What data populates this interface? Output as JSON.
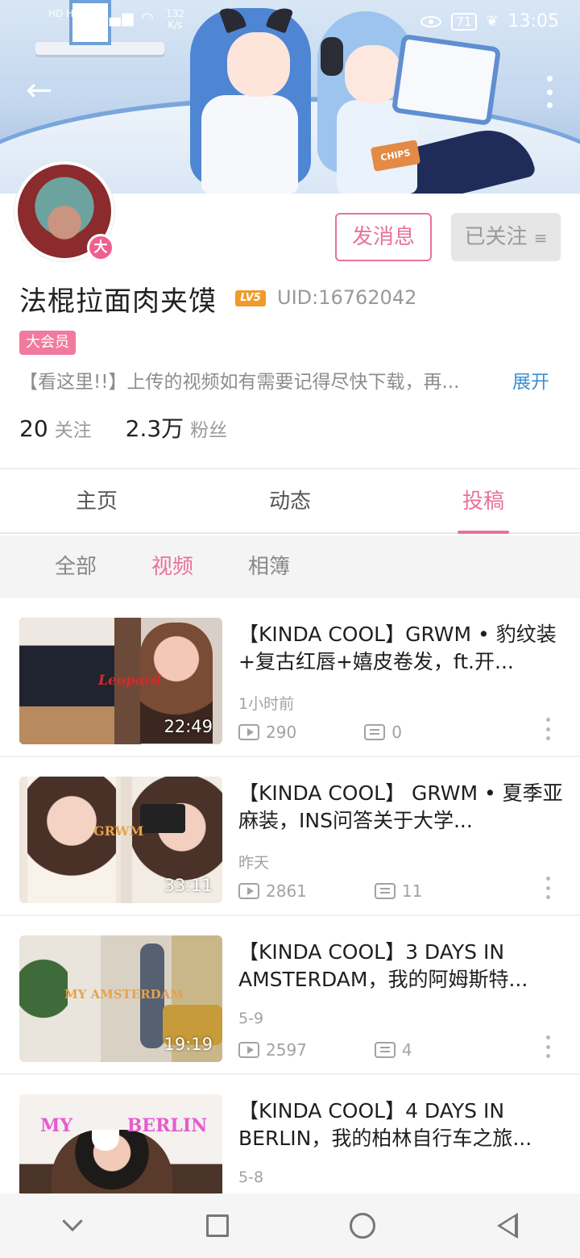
{
  "status_bar": {
    "network_left": "HD HD",
    "speed_value": "132",
    "speed_unit": "K/s",
    "battery": "71",
    "time": "13:05"
  },
  "banner": {
    "chips_text": "CHIPS"
  },
  "profile": {
    "avatar_badge": "大",
    "message_button": "发消息",
    "follow_button": "已关注",
    "name": "法棍拉面肉夹馍",
    "level_badge": "LV5",
    "uid": "UID:16762042",
    "member_tag": "大会员",
    "bio": "【看这里!!】上传的视频如有需要记得尽快下载，再...",
    "expand": "展开",
    "following_count": "20",
    "following_label": "关注",
    "followers_count": "2.3万",
    "followers_label": "粉丝"
  },
  "main_tabs": [
    {
      "label": "主页",
      "active": false
    },
    {
      "label": "动态",
      "active": false
    },
    {
      "label": "投稿",
      "active": true
    }
  ],
  "sub_tabs": [
    {
      "label": "全部",
      "active": false
    },
    {
      "label": "视频",
      "active": true
    },
    {
      "label": "相簿",
      "active": false
    }
  ],
  "videos": [
    {
      "title": "【KINDA COOL】GRWM • 豹纹装+复古红唇+嬉皮卷发，ft.开...",
      "time": "1小时前",
      "plays": "290",
      "comments": "0",
      "duration": "22:49",
      "thumb_label": "Leopard"
    },
    {
      "title": "【KINDA COOL】 GRWM • 夏季亚麻装，INS问答关于大学...",
      "time": "昨天",
      "plays": "2861",
      "comments": "11",
      "duration": "33:11",
      "thumb_label": "GRWM"
    },
    {
      "title": "【KINDA COOL】3 DAYS IN AMSTERDAM，我的阿姆斯特...",
      "time": "5-9",
      "plays": "2597",
      "comments": "4",
      "duration": "19:19",
      "thumb_label": "MY AMSTERDAM"
    },
    {
      "title": "【KINDA COOL】4 DAYS IN BERLIN，我的柏林自行车之旅...",
      "time": "5-8",
      "plays": "",
      "comments": "",
      "duration": "",
      "thumb_label": "MY BERLIN"
    }
  ],
  "icons": {
    "back": "arrow-left-icon",
    "more": "more-vertical-icon",
    "play": "play-count-icon",
    "comment": "comment-count-icon",
    "nav": [
      "chevron-down-icon",
      "square-recent-icon",
      "circle-home-icon",
      "triangle-back-icon"
    ]
  },
  "colors": {
    "accent": "#e9729a",
    "vip_badge": "#f0608f",
    "level_badge": "#f19a2c",
    "link": "#3d8fd6"
  }
}
